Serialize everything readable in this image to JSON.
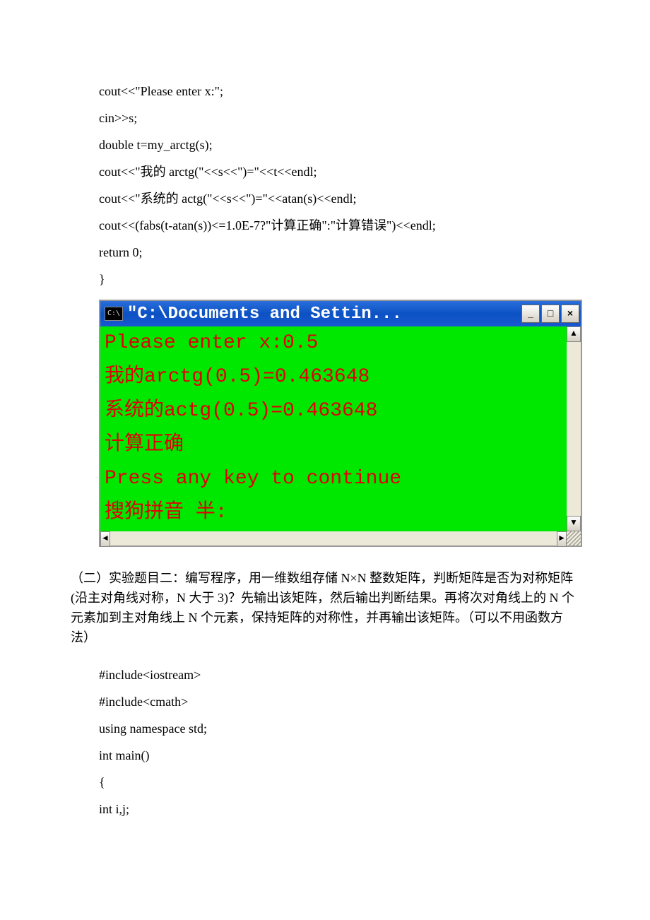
{
  "code1": {
    "l1": "cout<<\"Please enter x:\";",
    "l2": "cin>>s;",
    "l3": "double t=my_arctg(s);",
    "l4": "cout<<\"我的 arctg(\"<<s<<\")=\"<<t<<endl;",
    "l5": "cout<<\"系统的 actg(\"<<s<<\")=\"<<atan(s)<<endl;",
    "l6": "cout<<(fabs(t-atan(s))<=1.0E-7?\"计算正确\":\"计算错误\")<<endl;",
    "l7": "return 0;",
    "l8": "}"
  },
  "console": {
    "icon": "C:\\",
    "title": "\"C:\\Documents and Settin...",
    "btn_min": "_",
    "btn_max": "□",
    "btn_close": "×",
    "line1": "Please enter x:0.5",
    "line2": "我的arctg(0.5)=0.463648",
    "line3": "系统的actg(0.5)=0.463648",
    "line4": "计算正确",
    "line5": "Press any key to continue",
    "line6": "搜狗拼音 半:",
    "up": "▲",
    "down": "▼",
    "left": "◄",
    "right": "►"
  },
  "paragraph2": "（二）实验题目二：编写程序，用一维数组存储 N×N 整数矩阵，判断矩阵是否为对称矩阵(沿主对角线对称，N 大于 3)？先输出该矩阵，然后输出判断结果。再将次对角线上的 N 个元素加到主对角线上 N 个元素，保持矩阵的对称性，并再输出该矩阵。（可以不用函数方法）",
  "code2": {
    "l1": "#include<iostream>",
    "l2": "#include<cmath>",
    "l3": "using namespace std;",
    "l4": "int main()",
    "l5": "{",
    "l6": " int i,j;"
  }
}
